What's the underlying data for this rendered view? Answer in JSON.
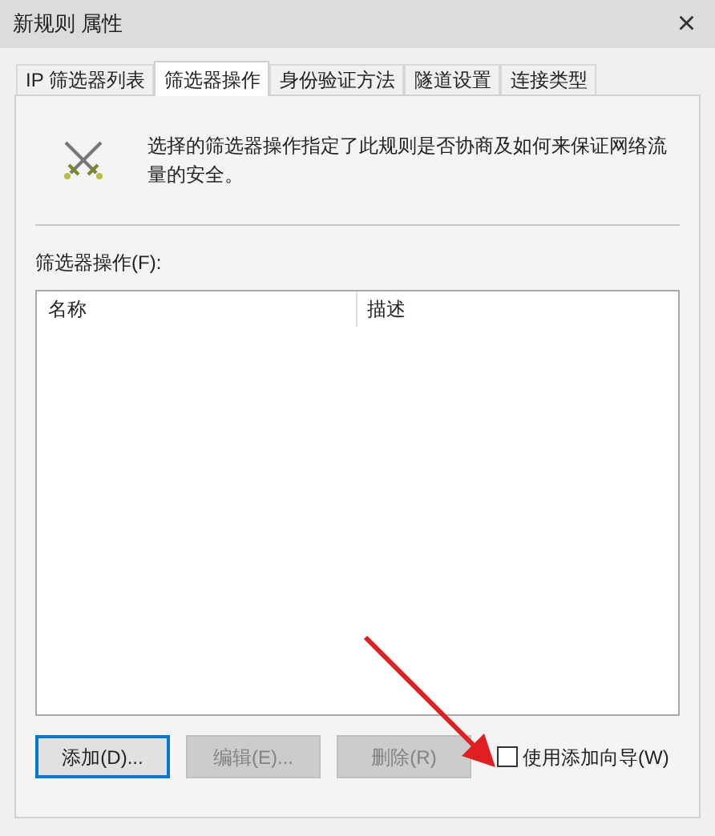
{
  "window": {
    "title": "新规则 属性",
    "close": "×"
  },
  "tabs": [
    {
      "label": "IP 筛选器列表",
      "selected": false
    },
    {
      "label": "筛选器操作",
      "selected": true
    },
    {
      "label": "身份验证方法",
      "selected": false
    },
    {
      "label": "隧道设置",
      "selected": false
    },
    {
      "label": "连接类型",
      "selected": false
    }
  ],
  "description": "选择的筛选器操作指定了此规则是否协商及如何来保证网络流量的安全。",
  "filter_actions": {
    "label": "筛选器操作(F):",
    "columns": [
      "名称",
      "描述"
    ]
  },
  "buttons": [
    {
      "label": "添加(D)...",
      "disabled": false
    },
    {
      "label": "编辑(E)...",
      "disabled": true
    },
    {
      "label": "删除(R)",
      "disabled": true
    }
  ],
  "wizard_checkbox": {
    "label": "使用添加向导(W)",
    "checked": false
  }
}
